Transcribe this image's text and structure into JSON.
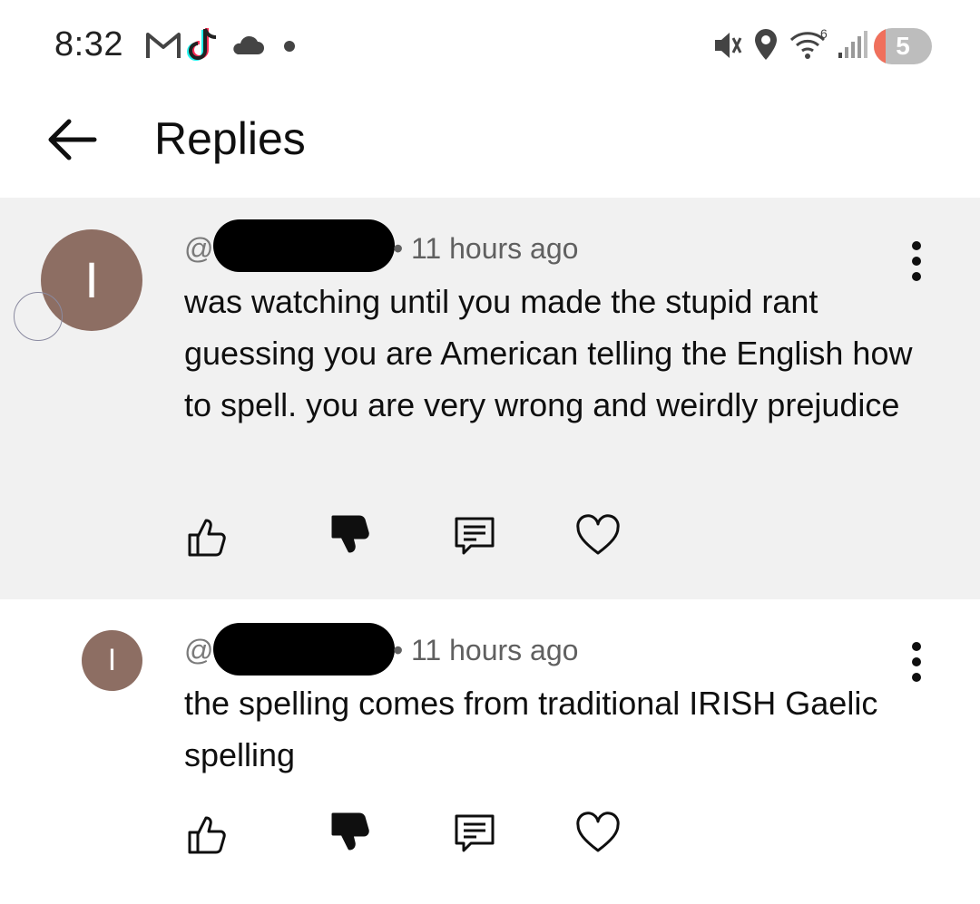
{
  "status_bar": {
    "time": "8:32",
    "battery_level": "5",
    "battery_fraction": 0.05,
    "wifi_label": "6",
    "icons": [
      "gmail-icon",
      "tiktok-icon",
      "cloud-icon",
      "dot-icon",
      "vibrate-icon",
      "location-icon",
      "wifi-icon",
      "signal-icon",
      "battery-icon"
    ]
  },
  "header": {
    "title": "Replies"
  },
  "comments": [
    {
      "avatar_letter": "I",
      "handle_prefix": "@",
      "timestamp": "11 hours ago",
      "text": "was watching until you made the stupid rant guessing you are American telling the English how to spell. you are very wrong and weirdly prejudice"
    },
    {
      "avatar_letter": "I",
      "handle_prefix": "@",
      "timestamp": "11 hours ago",
      "text": "the spelling comes from traditional IRISH Gaelic spelling"
    }
  ],
  "colors": {
    "highlight_bg": "#f1f1f1",
    "avatar_bg": "#8d6e63",
    "battery_low": "#f0705c",
    "meta_text": "#606060"
  }
}
